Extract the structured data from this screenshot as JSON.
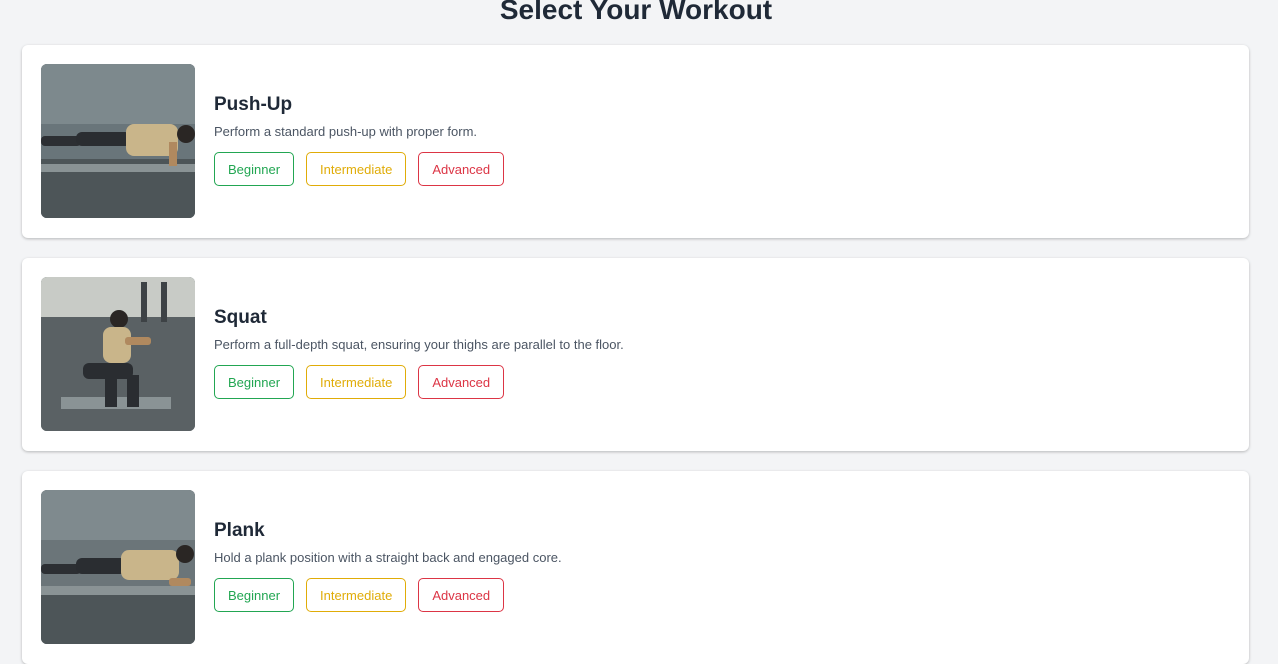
{
  "page": {
    "title": "Select Your Workout"
  },
  "colors": {
    "beginner": "#22a652",
    "intermediate": "#e0ac08",
    "advanced": "#dc3545",
    "background": "#f3f4f6"
  },
  "workouts": [
    {
      "name": "Push-Up",
      "description": "Perform a standard push-up with proper form.",
      "image": "push-up-photo",
      "levels": [
        "Beginner",
        "Intermediate",
        "Advanced"
      ]
    },
    {
      "name": "Squat",
      "description": "Perform a full-depth squat, ensuring your thighs are parallel to the floor.",
      "image": "squat-photo",
      "levels": [
        "Beginner",
        "Intermediate",
        "Advanced"
      ]
    },
    {
      "name": "Plank",
      "description": "Hold a plank position with a straight back and engaged core.",
      "image": "plank-photo",
      "levels": [
        "Beginner",
        "Intermediate",
        "Advanced"
      ]
    }
  ]
}
